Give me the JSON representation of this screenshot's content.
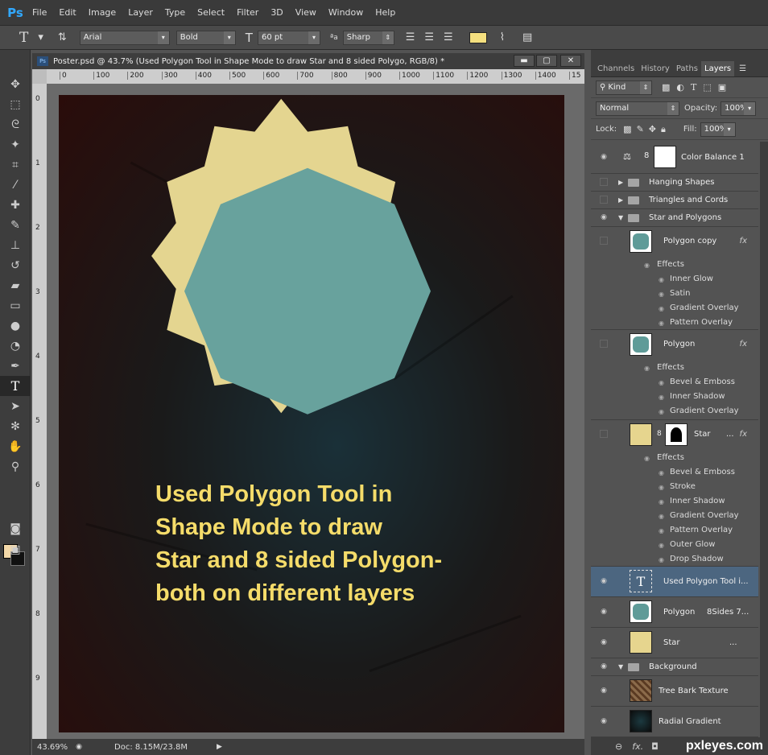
{
  "menubar": {
    "logo": "Ps",
    "items": [
      "File",
      "Edit",
      "Image",
      "Layer",
      "Type",
      "Select",
      "Filter",
      "3D",
      "View",
      "Window",
      "Help"
    ]
  },
  "options": {
    "tool_glyph": "T",
    "font_family": "Arial",
    "font_style": "Bold",
    "font_size": "60 pt",
    "antialias": "Sharp",
    "text_color": "#f5e07f"
  },
  "document": {
    "title": "Poster.psd @ 43.7% (Used Polygon Tool in Shape Mode to draw Star and 8 sided Polygo, RGB/8) *",
    "ruler_h": [
      "0",
      "100",
      "200",
      "300",
      "400",
      "500",
      "600",
      "700",
      "800",
      "900",
      "1000",
      "1100",
      "1200",
      "1300",
      "1400",
      "15"
    ],
    "ruler_v": [
      "0",
      "1",
      "2",
      "3",
      "4",
      "5",
      "6",
      "7",
      "8",
      "9",
      "1"
    ],
    "poster_lines": [
      "Used Polygon Tool in",
      "Shape Mode to draw",
      "Star and 8 sided Polygon-",
      "both on different layers"
    ],
    "zoom": "43.69%",
    "doc_info": "Doc: 8.15M/23.8M",
    "colors": {
      "star": "#e4d590",
      "polygon": "#68a29d",
      "text": "#f5dc6a"
    }
  },
  "panels": {
    "tabs": [
      "Channels",
      "History",
      "Paths",
      "Layers"
    ],
    "filter_kind": "Kind",
    "blend_mode": "Normal",
    "opacity_label": "Opacity:",
    "opacity_value": "100%",
    "lock_label": "Lock:",
    "fill_label": "Fill:",
    "fill_value": "100%",
    "layers": {
      "color_balance": "Color Balance 1",
      "hanging": "Hanging Shapes",
      "triangles": "Triangles and Cords",
      "star_polygons": "Star and Polygons",
      "polygon_copy": "Polygon copy",
      "polygon": "Polygon",
      "star": "Star",
      "star_dots": "...",
      "text_layer": "Used Polygon Tool i...",
      "polygon8": "Polygon",
      "polygon8_extra": "8Sides 7...",
      "star2": "Star",
      "star2_dots": "...",
      "background": "Background",
      "tree_bark": "Tree Bark Texture",
      "radial": "Radial Gradient"
    },
    "effects_label": "Effects",
    "fx_label": "fx",
    "polygon_copy_effects": [
      "Inner Glow",
      "Satin",
      "Gradient Overlay",
      "Pattern Overlay"
    ],
    "polygon_effects": [
      "Bevel & Emboss",
      "Inner Shadow",
      "Gradient Overlay"
    ],
    "star_effects": [
      "Bevel & Emboss",
      "Stroke",
      "Inner Shadow",
      "Gradient Overlay",
      "Pattern Overlay",
      "Outer Glow",
      "Drop Shadow"
    ]
  },
  "watermark": "pxleyes.com"
}
